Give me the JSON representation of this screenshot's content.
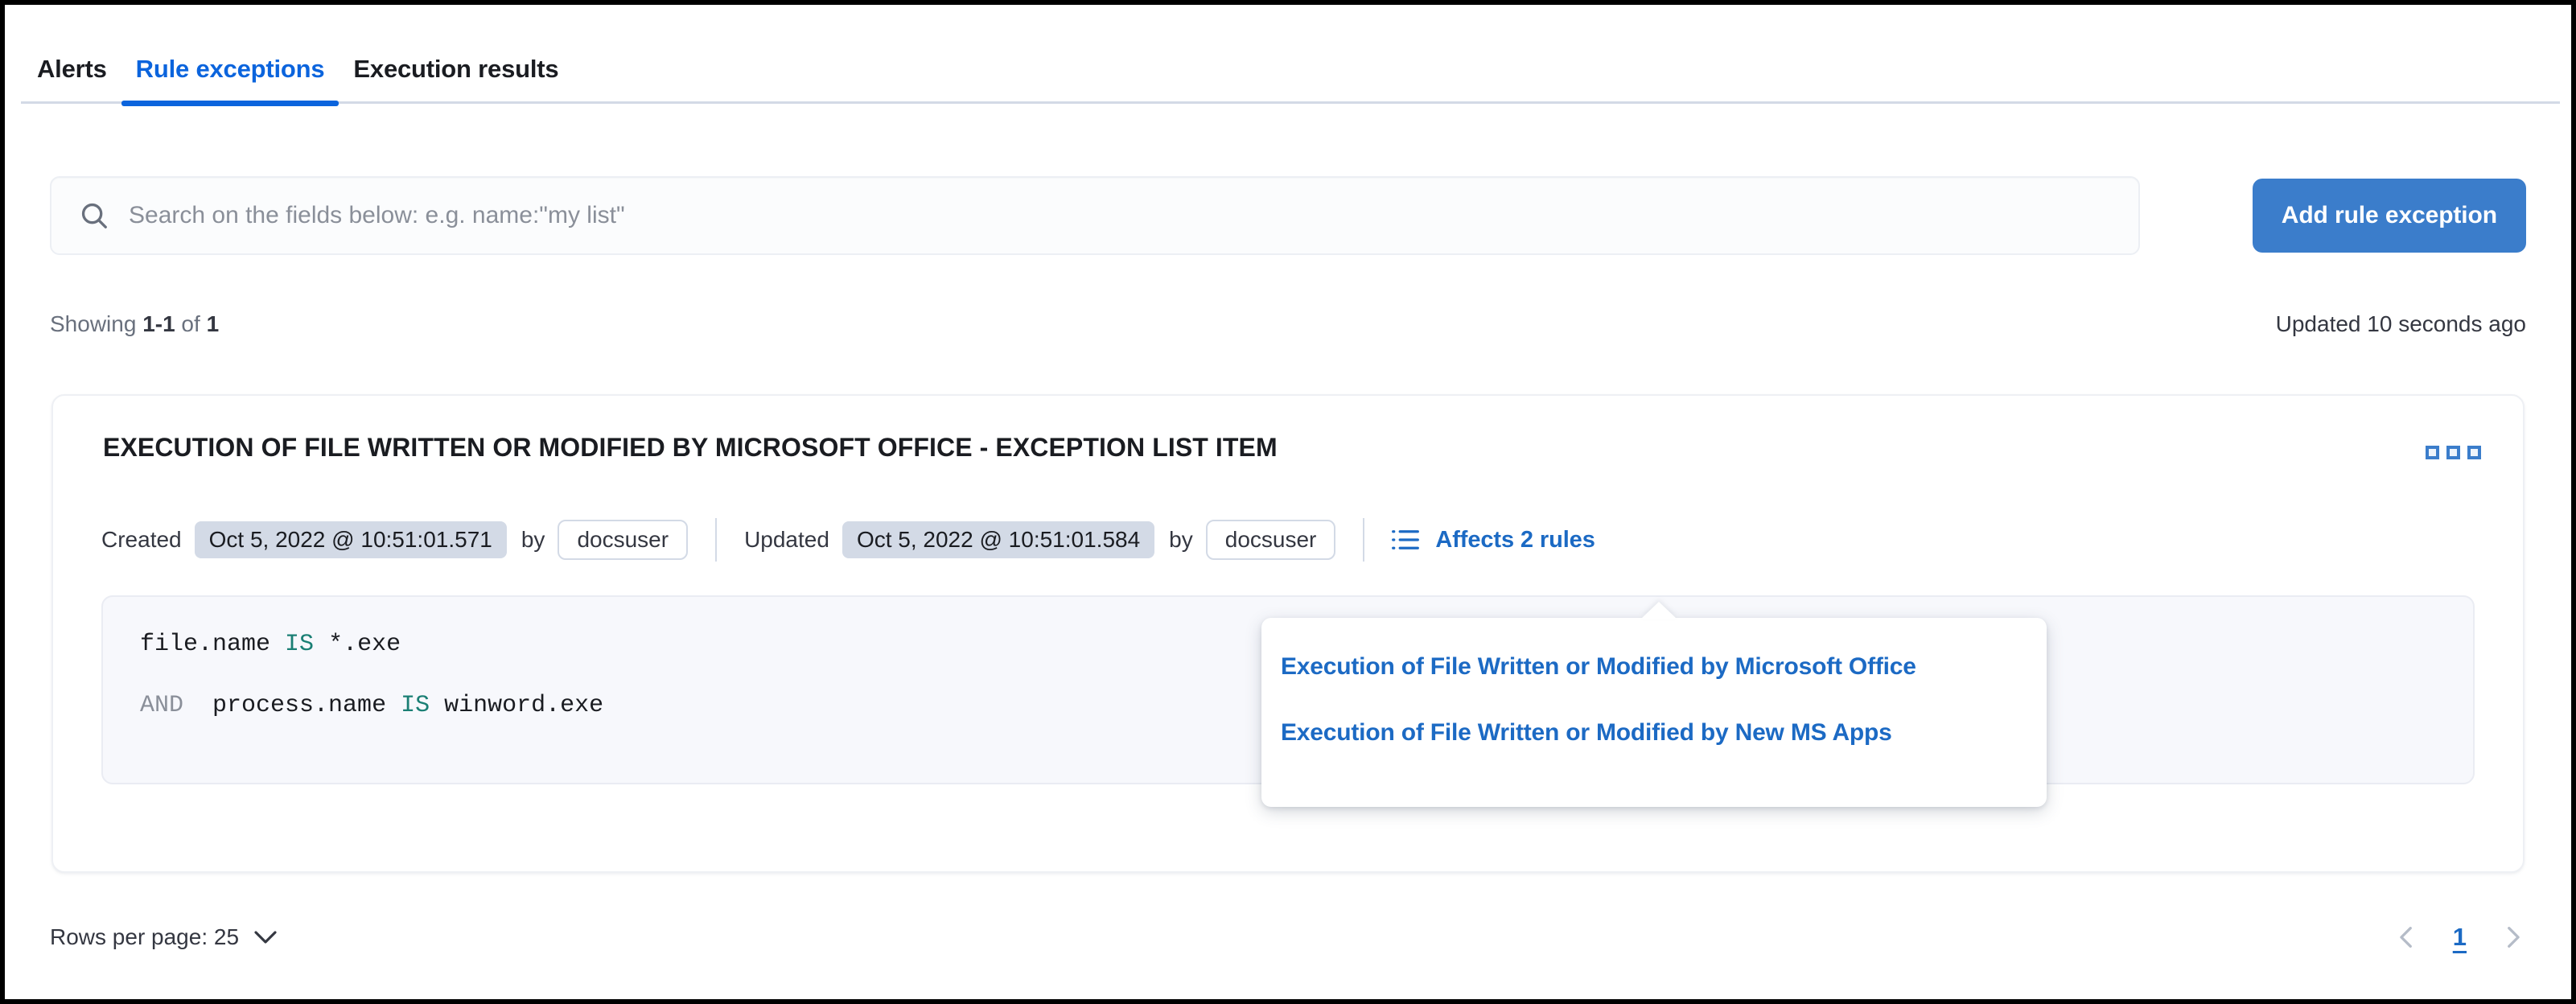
{
  "tabs": [
    {
      "label": "Alerts",
      "active": false
    },
    {
      "label": "Rule exceptions",
      "active": true
    },
    {
      "label": "Execution results",
      "active": false
    }
  ],
  "search": {
    "placeholder": "Search on the fields below: e.g. name:\"my list\"",
    "value": "",
    "icon": "search-icon"
  },
  "toolbar": {
    "add_label": "Add rule exception"
  },
  "meta": {
    "showing_prefix": "Showing ",
    "showing_range": "1-1",
    "showing_middle": " of ",
    "showing_total": "1",
    "updated_ago": "Updated 10 seconds ago"
  },
  "exception": {
    "title": "EXECUTION OF FILE WRITTEN OR MODIFIED BY MICROSOFT OFFICE - EXCEPTION LIST ITEM",
    "menu_icon": "boxes-horizontal-icon",
    "created_label": "Created",
    "created_timestamp": "Oct 5, 2022 @ 10:51:01.571",
    "created_by_label": "by",
    "created_by_user": "docsuser",
    "updated_label": "Updated",
    "updated_timestamp": "Oct 5, 2022 @ 10:51:01.584",
    "updated_by_label": "by",
    "updated_by_user": "docsuser",
    "affects_icon": "list-icon",
    "affects_label": "Affects 2 rules",
    "query": {
      "line1": {
        "field": "file.name",
        "operator": "IS",
        "value": "*.exe"
      },
      "line2": {
        "conjunction": "AND",
        "field": "process.name",
        "operator": "IS",
        "value": "winword.exe"
      }
    }
  },
  "popover": {
    "links": [
      "Execution of File Written or Modified by Microsoft Office",
      "Execution of File Written or Modified by New MS Apps"
    ]
  },
  "footer": {
    "rows_per_page_label": "Rows per page: 25",
    "chevron_icon": "chevron-down-icon",
    "prev_icon": "chevron-left-icon",
    "next_icon": "chevron-right-icon",
    "current_page": "1"
  },
  "colors": {
    "accent_blue": "#0b64dd",
    "link_blue": "#1c6ac4",
    "button_blue": "#3b7dcb",
    "badge_gray": "#d3dae6",
    "operator_teal": "#1a7f74",
    "text_dark": "#343741"
  }
}
